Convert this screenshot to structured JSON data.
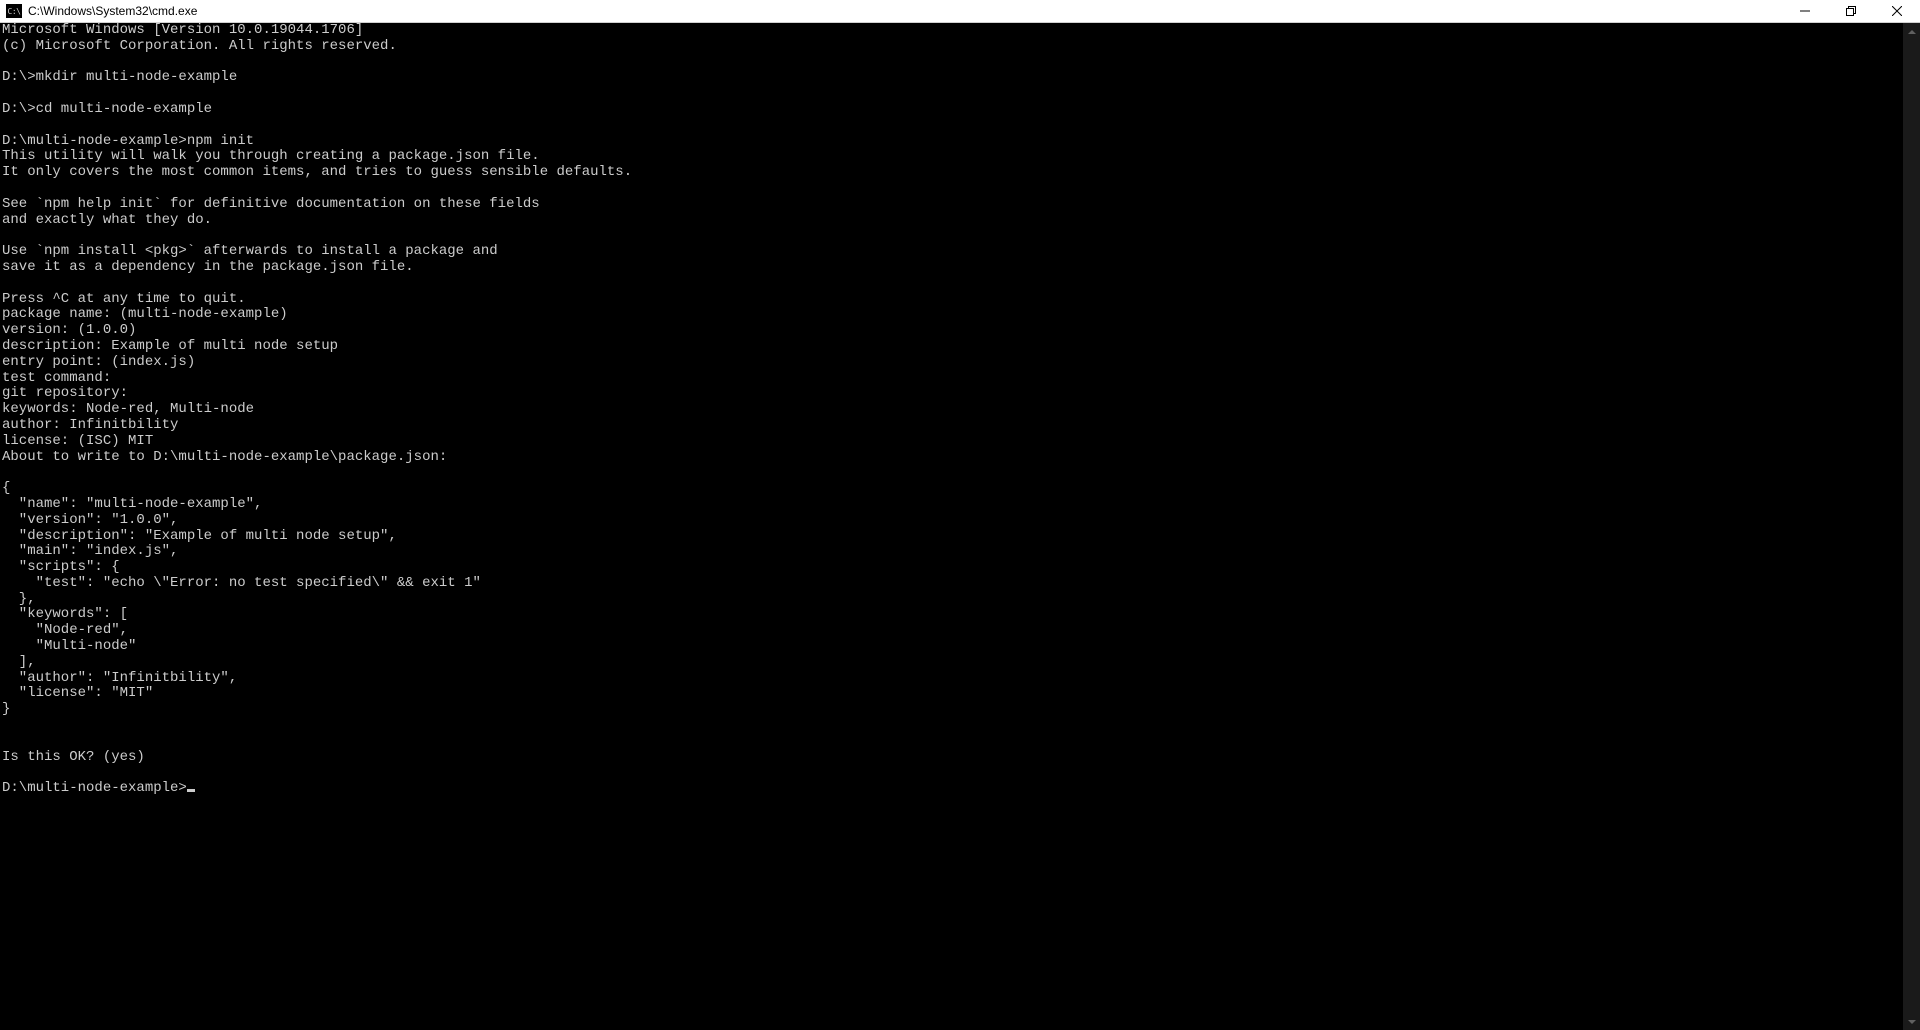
{
  "titlebar": {
    "icon_text": "C:\\",
    "title": "C:\\Windows\\System32\\cmd.exe"
  },
  "terminal": {
    "lines": [
      "Microsoft Windows [Version 10.0.19044.1706]",
      "(c) Microsoft Corporation. All rights reserved.",
      "",
      "D:\\>mkdir multi-node-example",
      "",
      "D:\\>cd multi-node-example",
      "",
      "D:\\multi-node-example>npm init",
      "This utility will walk you through creating a package.json file.",
      "It only covers the most common items, and tries to guess sensible defaults.",
      "",
      "See `npm help init` for definitive documentation on these fields",
      "and exactly what they do.",
      "",
      "Use `npm install <pkg>` afterwards to install a package and",
      "save it as a dependency in the package.json file.",
      "",
      "Press ^C at any time to quit.",
      "package name: (multi-node-example)",
      "version: (1.0.0)",
      "description: Example of multi node setup",
      "entry point: (index.js)",
      "test command:",
      "git repository:",
      "keywords: Node-red, Multi-node",
      "author: Infinitbility",
      "license: (ISC) MIT",
      "About to write to D:\\multi-node-example\\package.json:",
      "",
      "{",
      "  \"name\": \"multi-node-example\",",
      "  \"version\": \"1.0.0\",",
      "  \"description\": \"Example of multi node setup\",",
      "  \"main\": \"index.js\",",
      "  \"scripts\": {",
      "    \"test\": \"echo \\\"Error: no test specified\\\" && exit 1\"",
      "  },",
      "  \"keywords\": [",
      "    \"Node-red\",",
      "    \"Multi-node\"",
      "  ],",
      "  \"author\": \"Infinitbility\",",
      "  \"license\": \"MIT\"",
      "}",
      "",
      "",
      "Is this OK? (yes)",
      ""
    ],
    "prompt_line": "D:\\multi-node-example>"
  }
}
